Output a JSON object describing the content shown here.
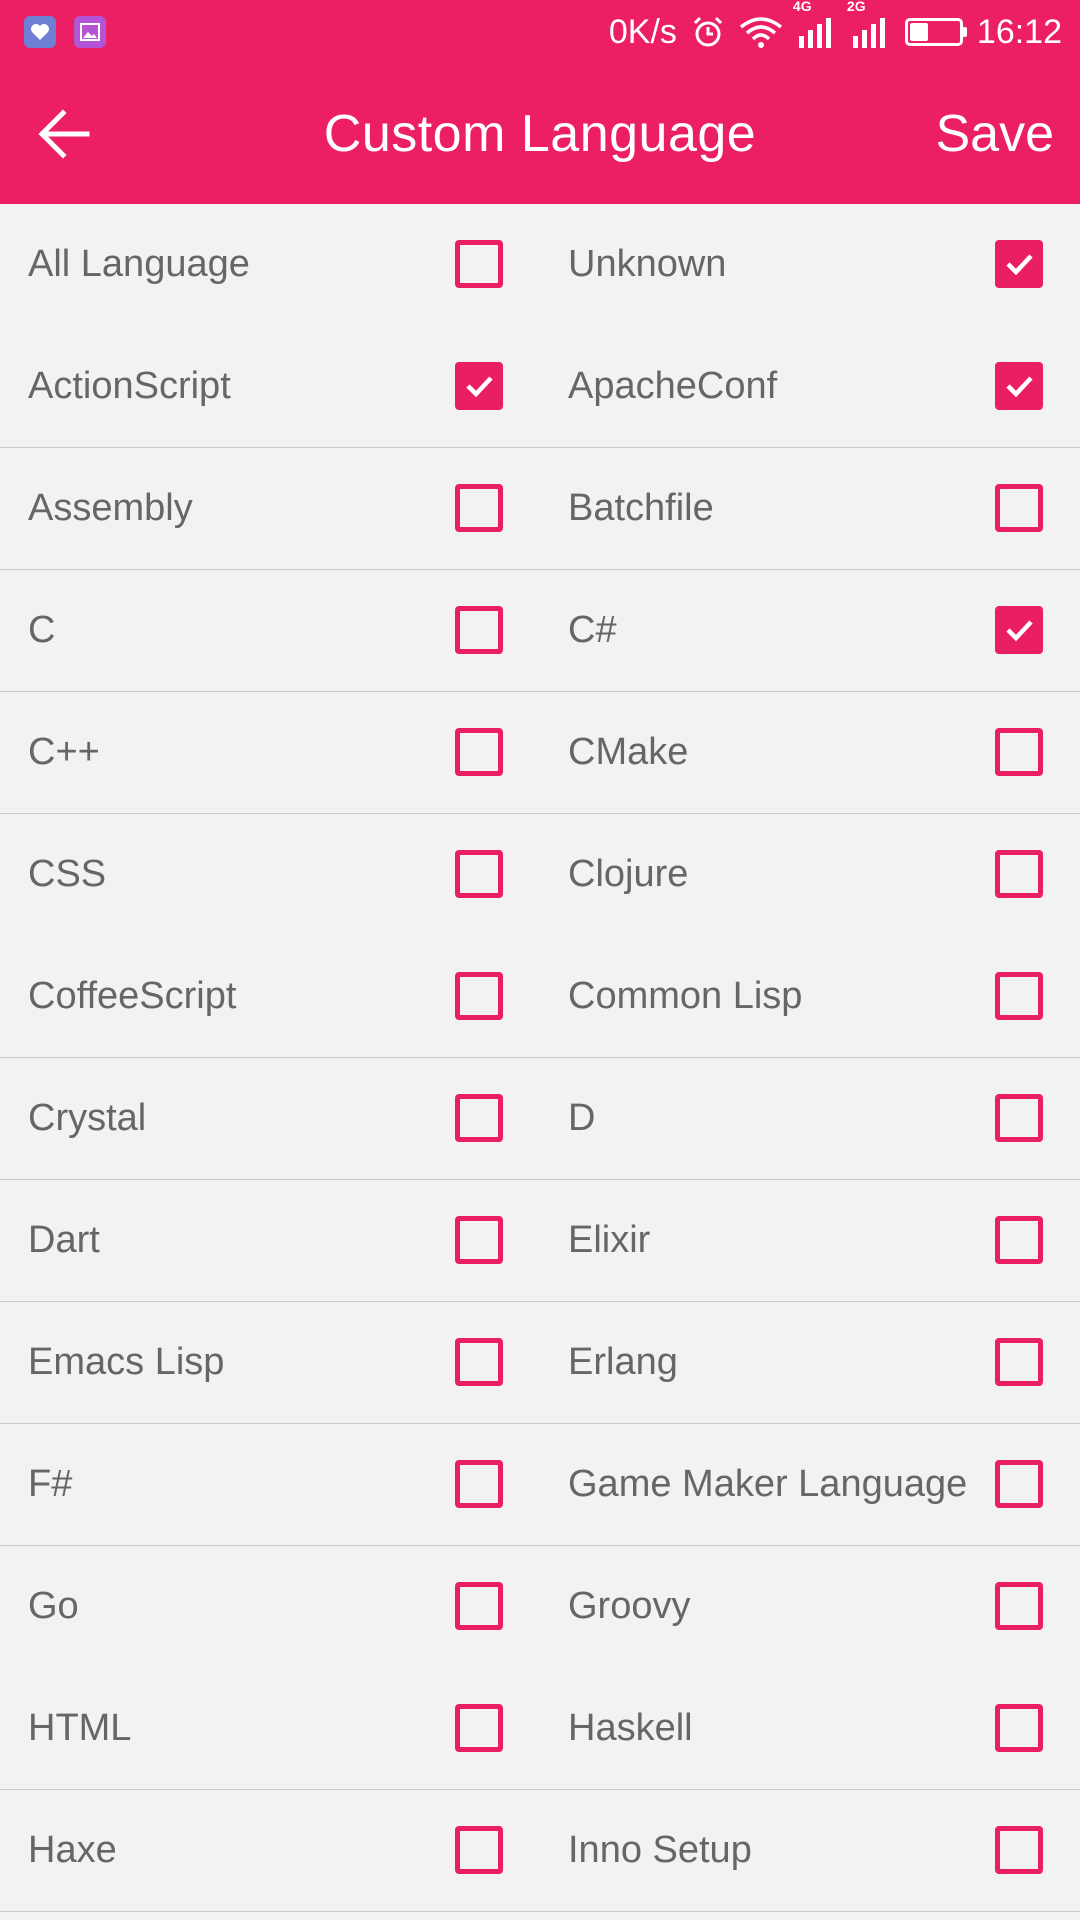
{
  "status_bar": {
    "net_speed": "0K/s",
    "network_1": "4G",
    "network_2": "2G",
    "time": "16:12",
    "battery_level": 0.35,
    "icons": [
      "notification-heart-icon",
      "gallery-icon",
      "alarm-icon",
      "wifi-icon",
      "signal-icon",
      "battery-icon"
    ]
  },
  "app_bar": {
    "title": "Custom Language",
    "save_label": "Save",
    "back_icon": "arrow-left-icon"
  },
  "colors": {
    "accent": "#ec1f64",
    "checkbox": "#e91e63",
    "text": "#666666",
    "background": "#f2f2f2"
  },
  "rows": [
    {
      "divider": false,
      "left": {
        "label": "All Language",
        "checked": false
      },
      "right": {
        "label": "Unknown",
        "checked": true
      }
    },
    {
      "divider": true,
      "left": {
        "label": "ActionScript",
        "checked": true
      },
      "right": {
        "label": "ApacheConf",
        "checked": true
      }
    },
    {
      "divider": true,
      "left": {
        "label": "Assembly",
        "checked": false
      },
      "right": {
        "label": "Batchfile",
        "checked": false
      }
    },
    {
      "divider": true,
      "left": {
        "label": "C",
        "checked": false
      },
      "right": {
        "label": "C#",
        "checked": true
      }
    },
    {
      "divider": true,
      "left": {
        "label": "C++",
        "checked": false
      },
      "right": {
        "label": "CMake",
        "checked": false
      }
    },
    {
      "divider": false,
      "left": {
        "label": "CSS",
        "checked": false
      },
      "right": {
        "label": "Clojure",
        "checked": false
      }
    },
    {
      "divider": true,
      "left": {
        "label": "CoffeeScript",
        "checked": false
      },
      "right": {
        "label": "Common Lisp",
        "checked": false
      }
    },
    {
      "divider": true,
      "left": {
        "label": "Crystal",
        "checked": false
      },
      "right": {
        "label": "D",
        "checked": false
      }
    },
    {
      "divider": true,
      "left": {
        "label": "Dart",
        "checked": false
      },
      "right": {
        "label": "Elixir",
        "checked": false
      }
    },
    {
      "divider": true,
      "left": {
        "label": "Emacs Lisp",
        "checked": false
      },
      "right": {
        "label": "Erlang",
        "checked": false
      }
    },
    {
      "divider": true,
      "left": {
        "label": "F#",
        "checked": false
      },
      "right": {
        "label": "Game Maker Language",
        "checked": false
      }
    },
    {
      "divider": false,
      "left": {
        "label": "Go",
        "checked": false
      },
      "right": {
        "label": "Groovy",
        "checked": false
      }
    },
    {
      "divider": true,
      "left": {
        "label": "HTML",
        "checked": false
      },
      "right": {
        "label": "Haskell",
        "checked": false
      }
    },
    {
      "divider": true,
      "left": {
        "label": "Haxe",
        "checked": false
      },
      "right": {
        "label": "Inno Setup",
        "checked": false
      }
    }
  ]
}
